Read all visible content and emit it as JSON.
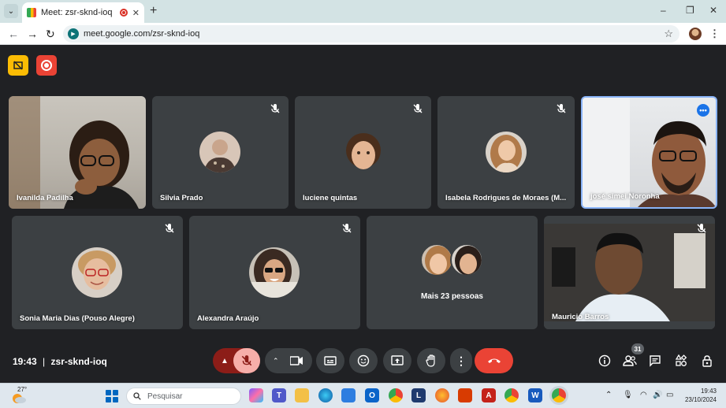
{
  "browser": {
    "tab_title": "Meet: zsr-sknd-ioq",
    "url": "meet.google.com/zsr-sknd-ioq",
    "new_tab_icon": "plus-icon",
    "minimize_icon": "–",
    "maximize_icon": "❐",
    "close_icon": "✕"
  },
  "participants": [
    {
      "name": "Ivanilda Padilha",
      "muted": false,
      "video": true
    },
    {
      "name": "Silvia Prado",
      "muted": true,
      "video": false
    },
    {
      "name": "luciene quintas",
      "muted": true,
      "video": false
    },
    {
      "name": "Isabela Rodrigues de Moraes (M...",
      "muted": true,
      "video": false
    },
    {
      "name": "josé simei Noronha",
      "muted": false,
      "video": true,
      "active_speaker": true
    },
    {
      "name": "Sonia Maria Dias (Pouso Alegre)",
      "muted": true,
      "video": false
    },
    {
      "name": "Alexandra Araújo",
      "muted": true,
      "video": false
    },
    {
      "name": "Mais 23 pessoas",
      "muted": false,
      "video": false
    },
    {
      "name": "Mauricio Barros",
      "muted": true,
      "video": true
    }
  ],
  "meeting": {
    "time": "19:43",
    "code": "zsr-sknd-ioq",
    "people_count": "31"
  },
  "taskbar": {
    "weather_temp": "27°",
    "search_placeholder": "Pesquisar",
    "clock_time": "19:43",
    "clock_date": "23/10/2024"
  },
  "colors": {
    "meet_bg": "#202124",
    "tile_bg": "#3c4043",
    "accent_red": "#ea4335",
    "accent_yellow": "#fbbc04",
    "speaker_border": "#8ab4f8"
  }
}
